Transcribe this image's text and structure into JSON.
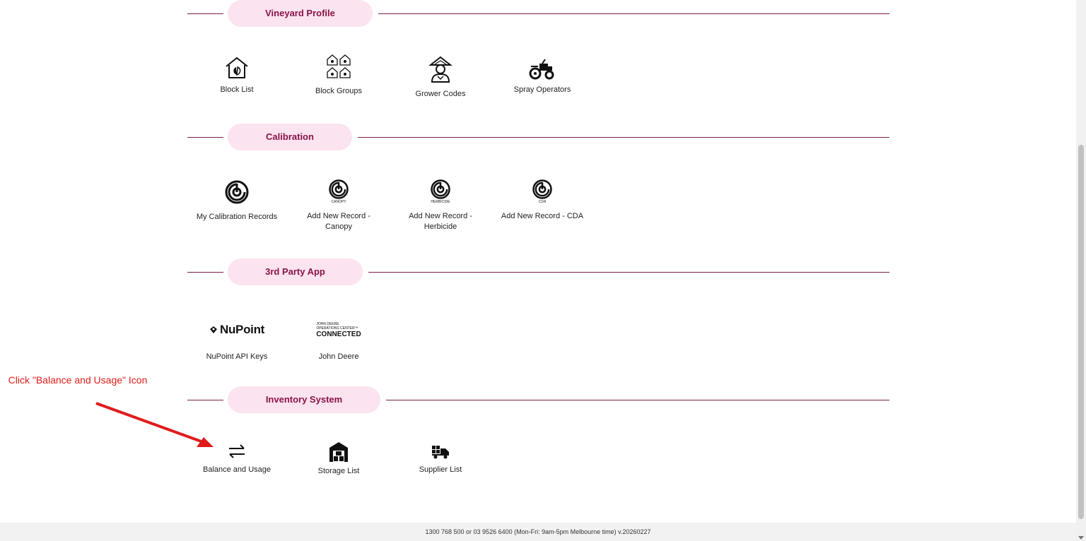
{
  "sections": {
    "vineyard_profile": {
      "title": "Vineyard Profile",
      "items": [
        {
          "label": "Block List",
          "icon": "house-leaf-icon"
        },
        {
          "label": "Block Groups",
          "icon": "house-grid-icon"
        },
        {
          "label": "Grower Codes",
          "icon": "farmer-icon"
        },
        {
          "label": "Spray Operators",
          "icon": "tractor-icon"
        }
      ]
    },
    "calibration": {
      "title": "Calibration",
      "items": [
        {
          "label": "My Calibration Records",
          "icon": "calibration-icon"
        },
        {
          "label": "Add New Record - Canopy",
          "icon": "calibration-canopy-icon",
          "badge": "CANOPY"
        },
        {
          "label": "Add New Record - Herbicide",
          "icon": "calibration-herbicide-icon",
          "badge": "HERBICIDE"
        },
        {
          "label": "Add New Record - CDA",
          "icon": "calibration-cda-icon",
          "badge": "CDA"
        }
      ]
    },
    "third_party": {
      "title": "3rd Party App",
      "items": [
        {
          "label": "NuPoint API Keys",
          "icon": "nupoint-logo-icon",
          "logo_text": "NuPoint"
        },
        {
          "label": "John Deere",
          "icon": "john-deere-logo-icon",
          "logo_line1": "JOHN DEERE",
          "logo_line2": "OPERATIONS CENTER™",
          "logo_line3": "CONNECTED"
        }
      ]
    },
    "inventory": {
      "title": "Inventory System",
      "items": [
        {
          "label": "Balance and Usage",
          "icon": "swap-arrows-icon"
        },
        {
          "label": "Storage List",
          "icon": "warehouse-icon"
        },
        {
          "label": "Supplier List",
          "icon": "delivery-truck-icon"
        }
      ]
    }
  },
  "annotation": {
    "text": "Click \"Balance and Usage\" Icon",
    "color": "#e01b1b"
  },
  "footer": {
    "text": "1300 768 500 or 03 9526 6400 (Mon-Fri: 9am-5pm Melbourne time) v.20260227"
  },
  "colors": {
    "accent": "#8a1448",
    "pill_bg": "#fbe3ef",
    "line": "#7a1f4a"
  }
}
